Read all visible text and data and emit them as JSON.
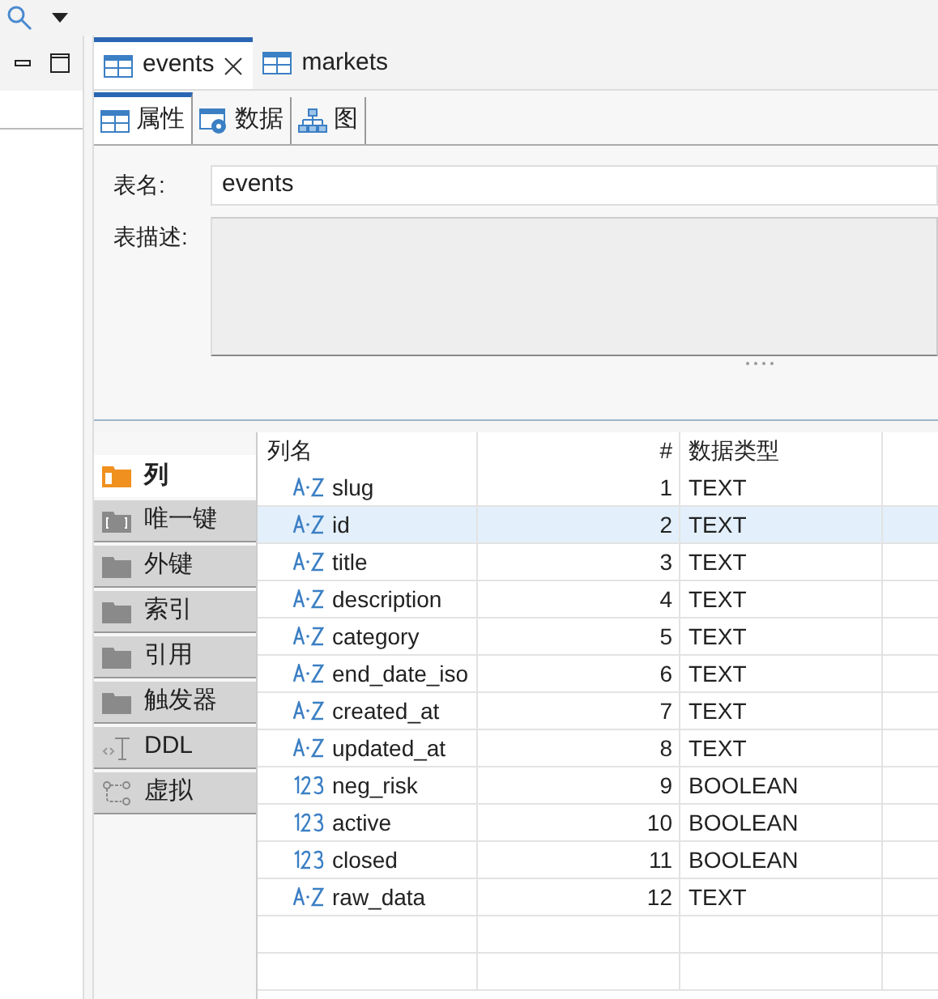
{
  "editor_tabs": [
    {
      "label": "events",
      "selected": true,
      "closable": true
    },
    {
      "label": "markets",
      "selected": false,
      "closable": false
    }
  ],
  "sub_tabs": [
    {
      "label": "属性",
      "selected": true,
      "kind": "table"
    },
    {
      "label": "数据",
      "selected": false,
      "kind": "data"
    },
    {
      "label": "图",
      "selected": false,
      "kind": "diagram"
    }
  ],
  "form": {
    "name_label": "表名:",
    "name_value": "events",
    "desc_label": "表描述:"
  },
  "side_tabs": [
    {
      "label": "列",
      "selected": true,
      "kind": "columns"
    },
    {
      "label": "唯一键",
      "selected": false,
      "kind": "key"
    },
    {
      "label": "外键",
      "selected": false,
      "kind": "folder"
    },
    {
      "label": "索引",
      "selected": false,
      "kind": "folder"
    },
    {
      "label": "引用",
      "selected": false,
      "kind": "folder"
    },
    {
      "label": "触发器",
      "selected": false,
      "kind": "folder"
    },
    {
      "label": "DDL",
      "selected": false,
      "kind": "ddl"
    },
    {
      "label": "虚拟",
      "selected": false,
      "kind": "virtual"
    }
  ],
  "table": {
    "columns": [
      "列名",
      "#",
      "数据类型"
    ],
    "rows": [
      {
        "name": "slug",
        "num": "1",
        "type": "TEXT",
        "kind": "text",
        "selected": false
      },
      {
        "name": "id",
        "num": "2",
        "type": "TEXT",
        "kind": "text",
        "selected": true
      },
      {
        "name": "title",
        "num": "3",
        "type": "TEXT",
        "kind": "text",
        "selected": false
      },
      {
        "name": "description",
        "num": "4",
        "type": "TEXT",
        "kind": "text",
        "selected": false
      },
      {
        "name": "category",
        "num": "5",
        "type": "TEXT",
        "kind": "text",
        "selected": false
      },
      {
        "name": "end_date_iso",
        "num": "6",
        "type": "TEXT",
        "kind": "text",
        "selected": false
      },
      {
        "name": "created_at",
        "num": "7",
        "type": "TEXT",
        "kind": "text",
        "selected": false
      },
      {
        "name": "updated_at",
        "num": "8",
        "type": "TEXT",
        "kind": "text",
        "selected": false
      },
      {
        "name": "neg_risk",
        "num": "9",
        "type": "BOOLEAN",
        "kind": "number",
        "selected": false
      },
      {
        "name": "active",
        "num": "10",
        "type": "BOOLEAN",
        "kind": "number",
        "selected": false
      },
      {
        "name": "closed",
        "num": "11",
        "type": "BOOLEAN",
        "kind": "number",
        "selected": false
      },
      {
        "name": "raw_data",
        "num": "12",
        "type": "TEXT",
        "kind": "text",
        "selected": false
      }
    ]
  }
}
